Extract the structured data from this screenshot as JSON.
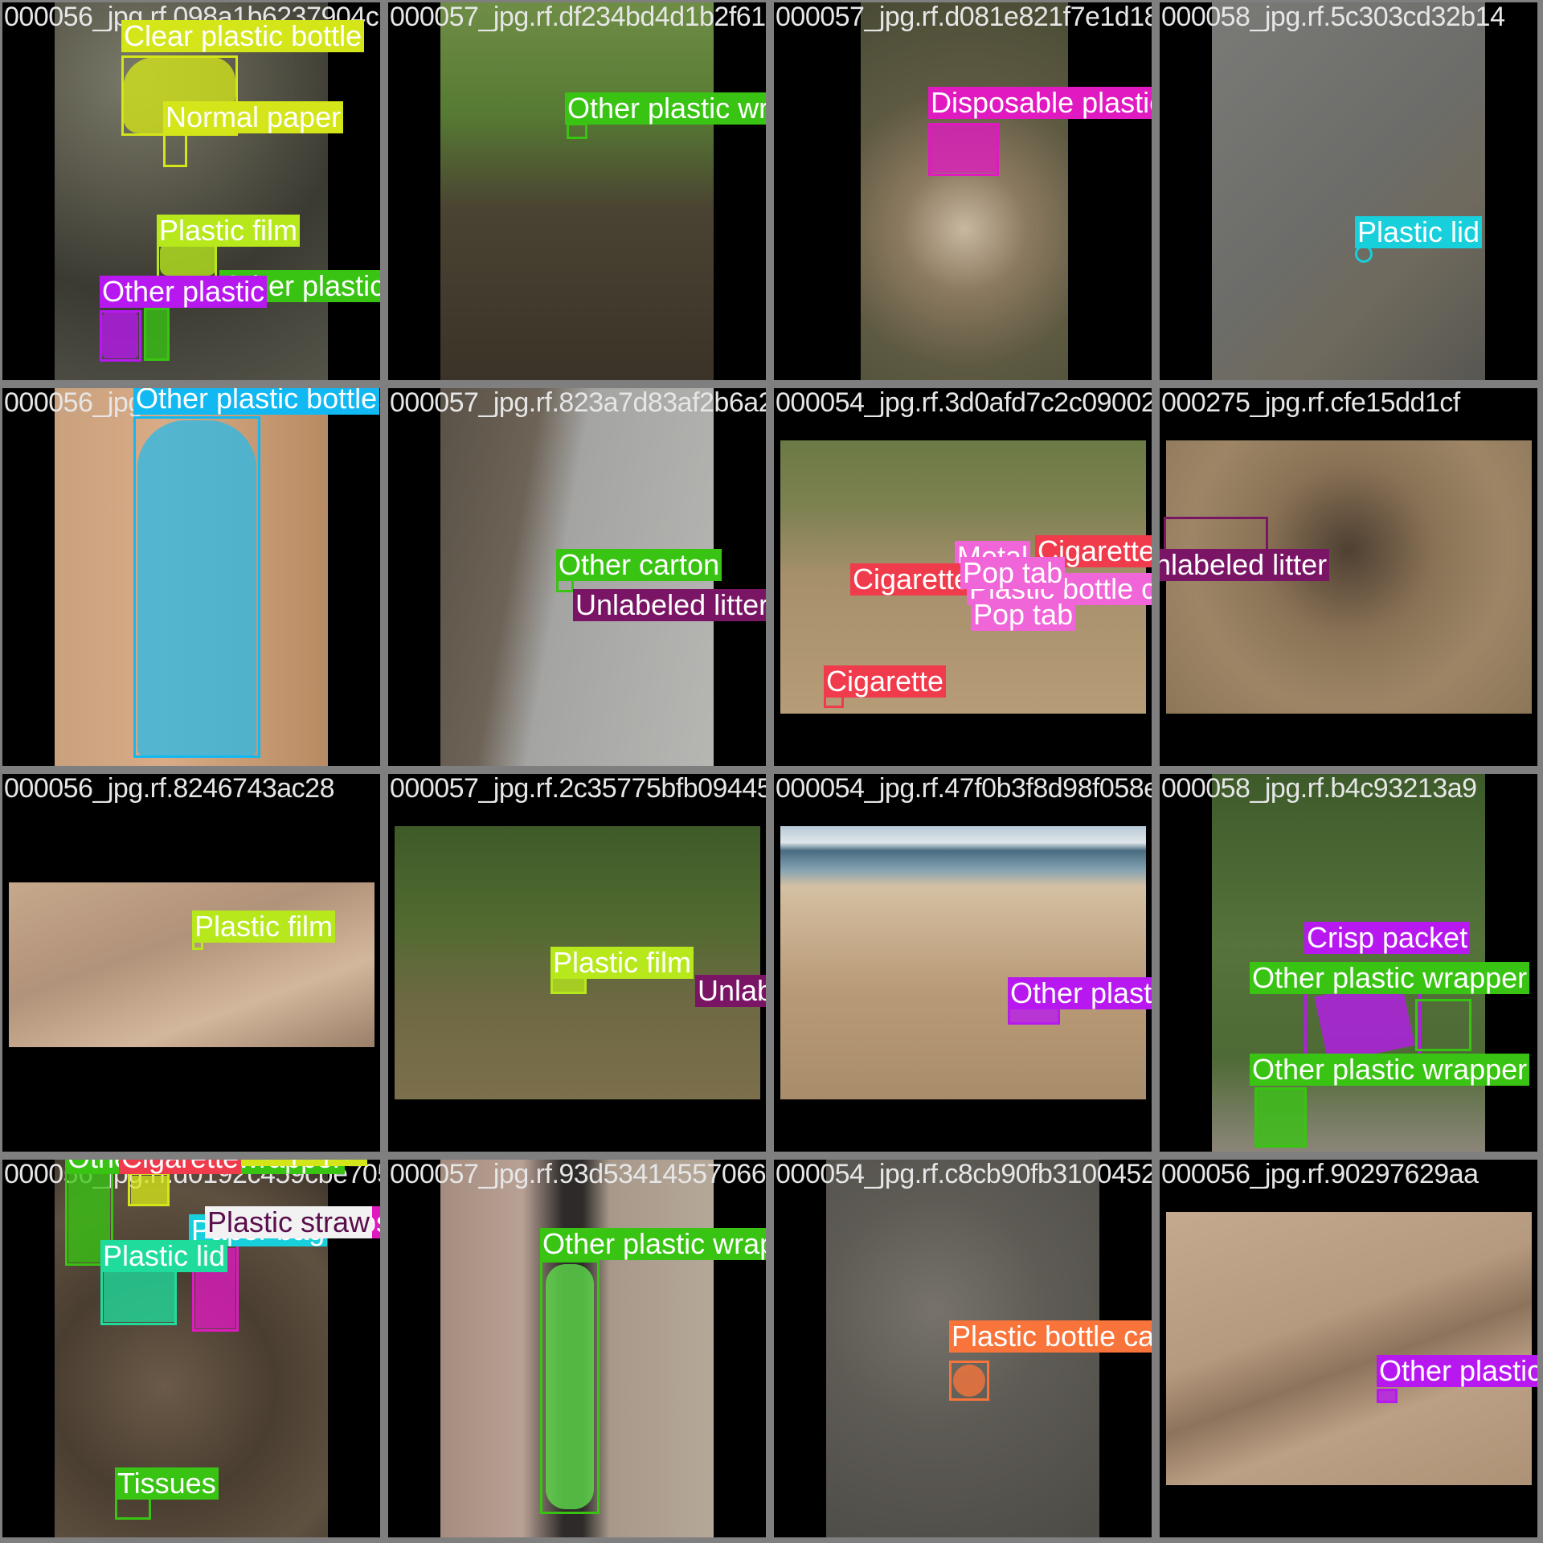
{
  "colors": {
    "yellow": "#d4e619",
    "lime": "#b7e81c",
    "green": "#39c413",
    "purple": "#b818f0",
    "blue": "#12b8f2",
    "cyan": "#18cfdc",
    "magenta": "#e019c0",
    "red": "#ef3b4b",
    "pink": "#f065d7",
    "plum": "#7a1565",
    "orange": "#f9743a",
    "mint": "#1fdc9d",
    "light": "#f2f2f2"
  },
  "tiles": [
    {
      "filename": "000056_jpg.rf.098a1b6237904c1...",
      "labels": [
        "Clear plastic bottle",
        "Normal paper",
        "Plastic film",
        "Other plastic wrapper",
        "Other plastic"
      ]
    },
    {
      "filename": "000057_jpg.rf.df234bd4d1b2f6185a6942fc0",
      "labels": [
        "Other plastic wrapper"
      ]
    },
    {
      "filename": "000057_jpg.rf.d081e821f7e1d183008851",
      "labels": [
        "Disposable plastic cup"
      ]
    },
    {
      "filename": "000058_jpg.rf.5c303cd32b14",
      "labels": [
        "Plastic lid"
      ]
    },
    {
      "filename": "000056_jpg.rf.102bd88e5a0b260a5d4d02ad",
      "labels": [
        "Other plastic bottle"
      ]
    },
    {
      "filename": "000057_jpg.rf.823a7d83af2b6a25a3a5f3f",
      "labels": [
        "Other carton",
        "Unlabeled litter"
      ]
    },
    {
      "filename": "000054_jpg.rf.3d0afd7c2c0900275c5f7909",
      "labels": [
        "Metal",
        "Cigarette",
        "Cigarette",
        "Pop tab",
        "Plastic bottle cap",
        "Pop tab",
        "Cigarette"
      ]
    },
    {
      "filename": "000275_jpg.rf.cfe15dd1cf",
      "labels": [
        "Unlabeled litter"
      ]
    },
    {
      "filename": "000056_jpg.rf.8246743ac28",
      "labels": [
        "Plastic film"
      ]
    },
    {
      "filename": "000057_jpg.rf.2c35775bfb09445a2f777c7a",
      "labels": [
        "Plastic film",
        "Unlabeled litter"
      ]
    },
    {
      "filename": "000054_jpg.rf.47f0b3f8d98f058e9887b4c93213a9",
      "labels": [
        "Other plastic"
      ]
    },
    {
      "filename": "000058_jpg.rf.b4c93213a9",
      "labels": [
        "Crisp packet",
        "Other plastic wrapper",
        "Other plastic wrapper"
      ]
    },
    {
      "filename": "000056_jpg.rf.d0192c459cbe7055a53d341455",
      "labels": [
        "Other plastic wrapper",
        "Cigarette",
        "Normal paper",
        "Plastic lid",
        "Plastic straw",
        "Disposable plastic cup",
        "Paper bag",
        "Tissues"
      ]
    },
    {
      "filename": "000057_jpg.rf.93d5341455706634b",
      "labels": [
        "Other plastic wrapper"
      ]
    },
    {
      "filename": "000054_jpg.rf.c8cb90fb3100452e5554c3",
      "labels": [
        "Plastic bottle cap"
      ]
    },
    {
      "filename": "000056_jpg.rf.90297629aa",
      "labels": [
        "Other plastic"
      ]
    }
  ]
}
